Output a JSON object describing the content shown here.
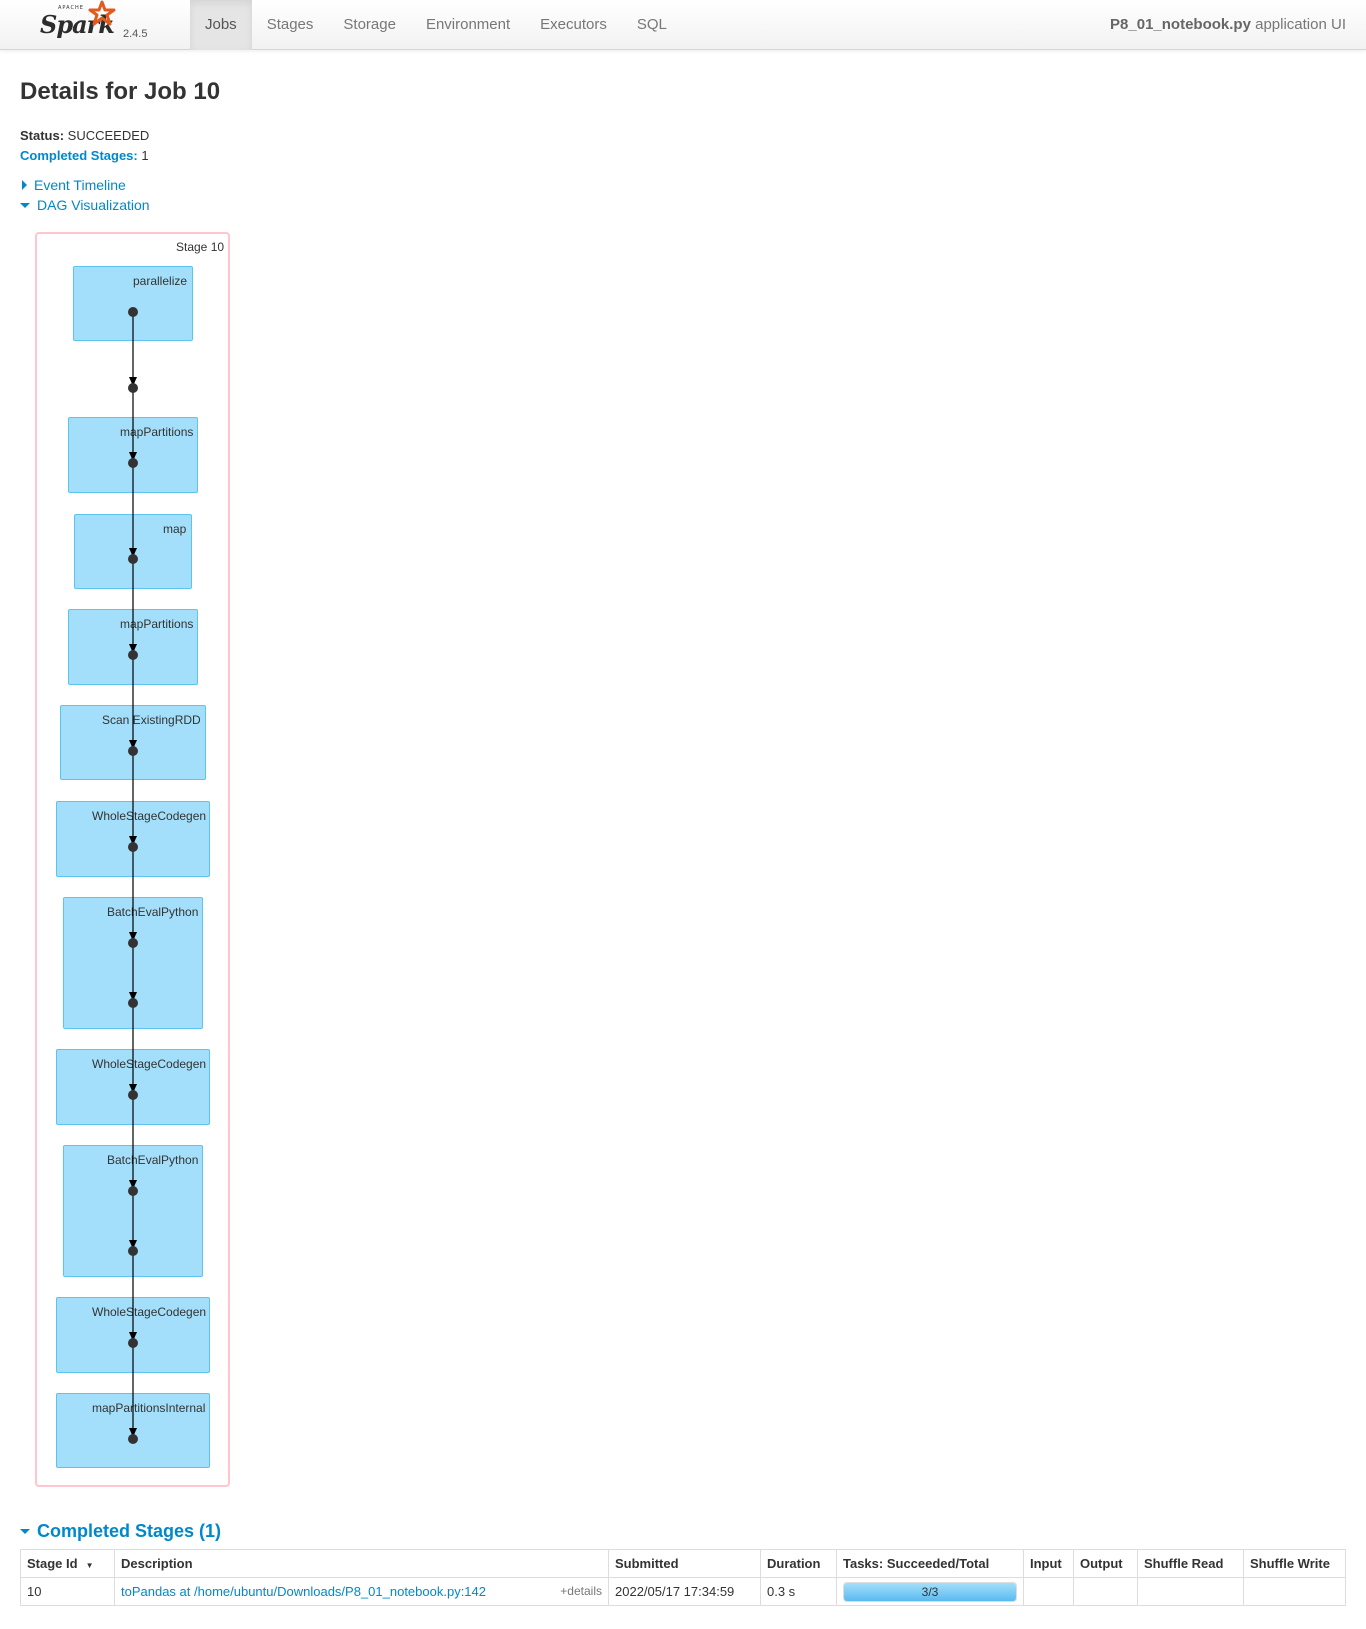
{
  "navbar": {
    "brand_apache": "APACHE",
    "brand_name": "Spark",
    "version": "2.4.5",
    "tabs": [
      {
        "label": "Jobs",
        "active": true
      },
      {
        "label": "Stages",
        "active": false
      },
      {
        "label": "Storage",
        "active": false
      },
      {
        "label": "Environment",
        "active": false
      },
      {
        "label": "Executors",
        "active": false
      },
      {
        "label": "SQL",
        "active": false
      }
    ],
    "app_file": "P8_01_notebook.py",
    "app_suffix": " application UI"
  },
  "page": {
    "title": "Details for Job 10",
    "status_label": "Status:",
    "status_value": " SUCCEEDED",
    "completed_label": "Completed Stages:",
    "completed_value": " 1",
    "event_timeline": "Event Timeline",
    "dag_visualization": "DAG Visualization"
  },
  "dag": {
    "stage_label": "Stage 10",
    "operations": [
      {
        "label": "parallelize"
      },
      {
        "label": "mapPartitions"
      },
      {
        "label": "map"
      },
      {
        "label": "mapPartitions"
      },
      {
        "label": "Scan ExistingRDD"
      },
      {
        "label": "WholeStageCodegen"
      },
      {
        "label": "BatchEvalPython"
      },
      {
        "label": "WholeStageCodegen"
      },
      {
        "label": "BatchEvalPython"
      },
      {
        "label": "WholeStageCodegen"
      },
      {
        "label": "mapPartitionsInternal"
      }
    ]
  },
  "completed_stages": {
    "heading": "Completed Stages (1)",
    "columns": [
      "Stage Id",
      "Description",
      "Submitted",
      "Duration",
      "Tasks: Succeeded/Total",
      "Input",
      "Output",
      "Shuffle Read",
      "Shuffle Write"
    ],
    "rows": [
      {
        "stage_id": "10",
        "description": "toPandas at /home/ubuntu/Downloads/P8_01_notebook.py:142",
        "details": "+details",
        "submitted": "2022/05/17 17:34:59",
        "duration": "0.3 s",
        "tasks": "3/3",
        "tasks_fraction": 1.0,
        "input": "",
        "output": "",
        "shuffle_read": "",
        "shuffle_write": ""
      }
    ]
  }
}
